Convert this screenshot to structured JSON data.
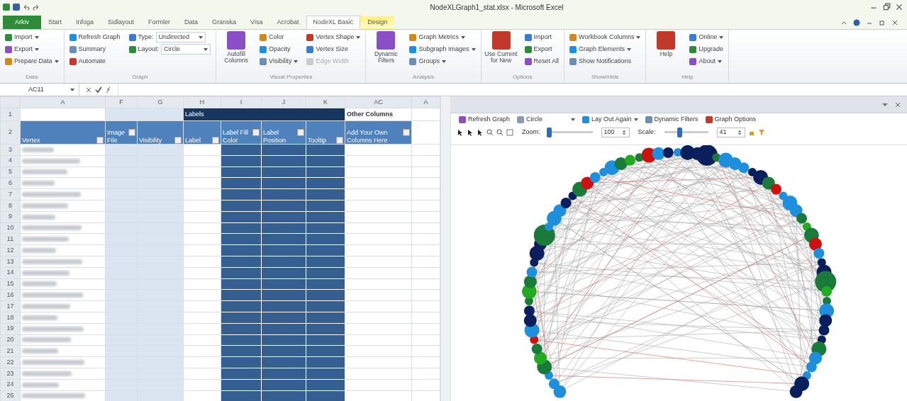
{
  "window": {
    "title": "NodeXLGraph1_stat.xlsx - Microsoft Excel"
  },
  "tabs": [
    {
      "label": "Arkiv",
      "kind": "file",
      "selected": false
    },
    {
      "label": "Start",
      "kind": "normal",
      "selected": false
    },
    {
      "label": "Infoga",
      "kind": "normal",
      "selected": false
    },
    {
      "label": "Sidlayout",
      "kind": "normal",
      "selected": false
    },
    {
      "label": "Formler",
      "kind": "normal",
      "selected": false
    },
    {
      "label": "Data",
      "kind": "normal",
      "selected": false
    },
    {
      "label": "Granska",
      "kind": "normal",
      "selected": false
    },
    {
      "label": "Visa",
      "kind": "normal",
      "selected": false
    },
    {
      "label": "Acrobat",
      "kind": "normal",
      "selected": false
    },
    {
      "label": "NodeXL Basic",
      "kind": "normal",
      "selected": true
    },
    {
      "label": "Design",
      "kind": "contextual",
      "selected": false
    }
  ],
  "ribbon": {
    "groups": [
      {
        "label": "Data",
        "columns": [
          {
            "kind": "stack",
            "items": [
              {
                "label": "Import",
                "dropdown": true,
                "disabled": false
              },
              {
                "label": "Export",
                "dropdown": true,
                "disabled": false
              },
              {
                "label": "Prepare Data",
                "dropdown": true,
                "disabled": false
              }
            ]
          }
        ]
      },
      {
        "label": "Graph",
        "columns": [
          {
            "kind": "stack",
            "items": [
              {
                "label": "Refresh Graph",
                "dropdown": false,
                "disabled": false
              },
              {
                "label": "Summary",
                "dropdown": false,
                "disabled": false
              },
              {
                "label": "Automate",
                "dropdown": false,
                "disabled": false
              }
            ]
          },
          {
            "kind": "fields",
            "items": [
              {
                "label": "Type:",
                "value": "Undirected"
              },
              {
                "label": "Layout:",
                "value": "Circle"
              }
            ]
          }
        ]
      },
      {
        "label": "Visual Properties",
        "columns": [
          {
            "kind": "big",
            "items": [
              {
                "label": "Autofill Columns",
                "dropdown": false,
                "disabled": false
              }
            ]
          },
          {
            "kind": "stack",
            "items": [
              {
                "label": "Color",
                "dropdown": false,
                "disabled": false
              },
              {
                "label": "Opacity",
                "dropdown": false,
                "disabled": false
              },
              {
                "label": "Visibility",
                "dropdown": true,
                "disabled": false
              }
            ]
          },
          {
            "kind": "stack",
            "items": [
              {
                "label": "Vertex Shape",
                "dropdown": true,
                "disabled": false
              },
              {
                "label": "Vertex Size",
                "dropdown": false,
                "disabled": false
              },
              {
                "label": "Edge Width",
                "dropdown": false,
                "disabled": true
              }
            ]
          }
        ]
      },
      {
        "label": "Analysis",
        "columns": [
          {
            "kind": "big",
            "items": [
              {
                "label": "Dynamic Filters",
                "dropdown": false,
                "disabled": false
              }
            ]
          },
          {
            "kind": "stack",
            "items": [
              {
                "label": "Graph Metrics",
                "dropdown": true,
                "disabled": false
              },
              {
                "label": "Subgraph Images",
                "dropdown": true,
                "disabled": false
              },
              {
                "label": "Groups",
                "dropdown": true,
                "disabled": false
              }
            ]
          }
        ]
      },
      {
        "label": "Options",
        "columns": [
          {
            "kind": "big",
            "items": [
              {
                "label": "Use Current for New",
                "dropdown": false,
                "disabled": false
              }
            ]
          },
          {
            "kind": "stack",
            "items": [
              {
                "label": "Import",
                "dropdown": false,
                "disabled": false
              },
              {
                "label": "Export",
                "dropdown": false,
                "disabled": false
              },
              {
                "label": "Reset All",
                "dropdown": false,
                "disabled": false
              }
            ]
          }
        ]
      },
      {
        "label": "Show/Hide",
        "columns": [
          {
            "kind": "stack",
            "items": [
              {
                "label": "Workbook Columns",
                "dropdown": true,
                "disabled": false
              },
              {
                "label": "Graph Elements",
                "dropdown": true,
                "disabled": false
              },
              {
                "label": "Show Notifications",
                "dropdown": false,
                "disabled": false
              }
            ]
          }
        ]
      },
      {
        "label": "Help",
        "columns": [
          {
            "kind": "big",
            "items": [
              {
                "label": "Help",
                "dropdown": false,
                "disabled": false
              }
            ]
          },
          {
            "kind": "stack",
            "items": [
              {
                "label": "Online",
                "dropdown": true,
                "disabled": false
              },
              {
                "label": "Upgrade",
                "dropdown": false,
                "disabled": false
              },
              {
                "label": "About",
                "dropdown": true,
                "disabled": false
              }
            ]
          }
        ]
      }
    ]
  },
  "formula_bar": {
    "name_box": "AC11"
  },
  "sheet": {
    "column_groups": [
      {
        "kind": "plain",
        "columns": [
          {
            "letter": "A",
            "kind": "vertex",
            "header": "Vertex"
          }
        ]
      },
      {
        "kind": "light",
        "columns": [
          {
            "letter": "F",
            "kind": "light",
            "header": "Image File"
          },
          {
            "letter": "G",
            "kind": "light",
            "header": "Visibility"
          }
        ]
      },
      {
        "kind": "band",
        "label": "Labels",
        "columns": [
          {
            "letter": "H",
            "kind": "plain",
            "header": "Label"
          },
          {
            "letter": "I",
            "kind": "dark",
            "header": "Label Fill Color"
          },
          {
            "letter": "J",
            "kind": "dark",
            "header": "Label Position"
          },
          {
            "letter": "K",
            "kind": "dark",
            "header": "Tooltip"
          }
        ]
      },
      {
        "kind": "plain",
        "label": "Other Columns",
        "columns": [
          {
            "letter": "AC",
            "kind": "plain",
            "header": "Add Your Own Columns Here"
          }
        ]
      },
      {
        "kind": "plain",
        "columns": [
          {
            "letter": "A",
            "kind": "plain"
          }
        ]
      }
    ],
    "header_rows": [
      "1",
      "2"
    ],
    "rows": [
      "3",
      "4",
      "5",
      "6",
      "7",
      "8",
      "9",
      "10",
      "11",
      "12",
      "13",
      "14",
      "15",
      "16",
      "17",
      "18",
      "19",
      "20",
      "21",
      "22",
      "23",
      "24",
      "25"
    ]
  },
  "graph_pane": {
    "toolbar": [
      {
        "kind": "button",
        "label": "Refresh Graph",
        "dropdown": false
      },
      {
        "kind": "combo",
        "label": "Circle",
        "dropdown": true
      },
      {
        "kind": "button",
        "label": "Lay Out Again",
        "dropdown": true
      },
      {
        "kind": "button",
        "label": "Dynamic Filters",
        "dropdown": false
      },
      {
        "kind": "button",
        "label": "Graph Options",
        "dropdown": false
      }
    ],
    "zoom": {
      "label": "Zoom:",
      "level": 0.0,
      "value": "100"
    },
    "scale": {
      "label": "Scale:",
      "level": 0.35,
      "value": "41"
    }
  }
}
